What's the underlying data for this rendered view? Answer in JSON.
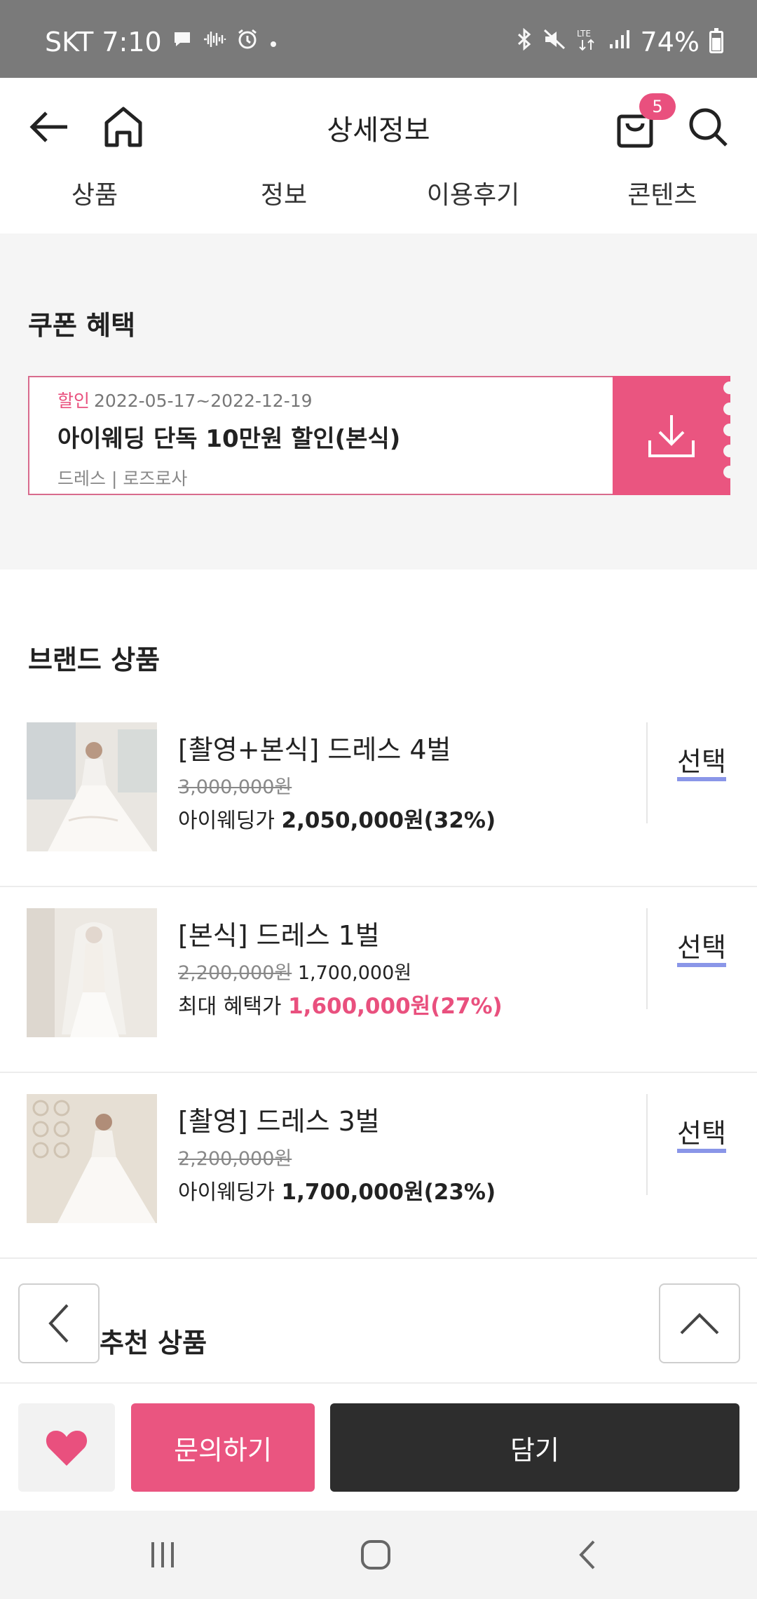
{
  "status_bar": {
    "carrier_time": "SKT 7:10",
    "right_indicators": "LTE",
    "battery": "74%",
    "icons": [
      "message-icon",
      "audio-icon",
      "alarm-icon",
      "dot-icon",
      "bluetooth-icon",
      "mute-icon",
      "lte-icon",
      "signal-icon",
      "battery-icon"
    ]
  },
  "header": {
    "title": "상세정보",
    "cart_badge": "5",
    "icons": [
      "back-arrow-icon",
      "home-icon",
      "shopping-bag-icon",
      "search-icon"
    ]
  },
  "tabs": [
    "상품",
    "정보",
    "이용후기",
    "콘텐츠"
  ],
  "coupon": {
    "section_title": "쿠폰 혜택",
    "tag": "할인",
    "period": "2022-05-17~2022-12-19",
    "name": "아이웨딩 단독 10만원 할인(본식)",
    "category": "드레스",
    "separator": "|",
    "brand": "로즈로사",
    "accent_color": "#ea5580"
  },
  "brand_products": {
    "section_title": "브랜드 상품",
    "items": [
      {
        "name": "[촬영+본식] 드레스 4벌",
        "original_price": "3,000,000원",
        "sale_price": "",
        "price_label": "아이웨딩가",
        "price": "2,050,000원(32%)",
        "select_label": "선택"
      },
      {
        "name": "[본식] 드레스 1벌",
        "original_price": "2,200,000원",
        "sale_price": "1,700,000원",
        "price_label": "최대 혜택가",
        "price": "1,600,000원(27%)",
        "select_label": "선택"
      },
      {
        "name": "[촬영] 드레스 3벌",
        "original_price": "2,200,000원",
        "sale_price": "",
        "price_label": "아이웨딩가",
        "price": "1,700,000원(23%)",
        "select_label": "선택"
      }
    ]
  },
  "recommended": {
    "section_title": "추천 상품"
  },
  "actions": {
    "inquiry_label": "문의하기",
    "add_label": "담기"
  }
}
